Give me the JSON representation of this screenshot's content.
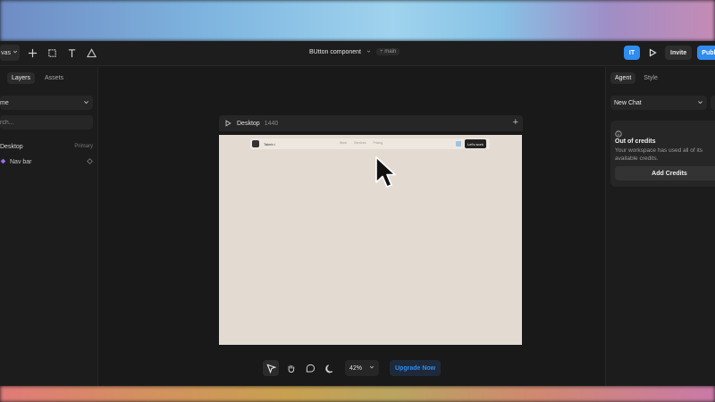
{
  "app": {
    "project_title": "BUtton component",
    "branch": "main",
    "mode_label": "vas",
    "avatar_initials": "IT",
    "invite_label": "Invite",
    "publish_label": "Publ"
  },
  "left_panel": {
    "tabs": [
      "Layers",
      "Assets"
    ],
    "page_select": "me",
    "search_placeholder": "rch...",
    "layers": {
      "frame_name": "Desktop",
      "frame_tag": "Primary",
      "child_name": "Nav bar"
    }
  },
  "canvas": {
    "frame_name": "Desktop",
    "frame_size": "1440",
    "preview": {
      "brand": "Takeb.i",
      "links": [
        "Work",
        "Services",
        "Pricing"
      ],
      "cta": "Let's work"
    },
    "zoom": "42%",
    "upgrade_label": "Upgrade Now"
  },
  "right_panel": {
    "tabs": [
      "Agent",
      "Style"
    ],
    "chat_select": "New Chat",
    "credits": {
      "title": "Out of credits",
      "description": "Your workspace has used all of its available credits.",
      "button": "Add Credits"
    }
  },
  "colors": {
    "accent": "#2f8cf0",
    "panel": "#1c1c1c",
    "canvas": "#191919",
    "frame_bg": "#e3dbd2"
  },
  "icons": [
    "plus-icon",
    "frame-icon",
    "text-icon",
    "triangle-icon",
    "play-icon",
    "pointer-icon",
    "hand-icon",
    "comment-icon",
    "moon-icon",
    "chevron-down-icon",
    "info-icon",
    "component-icon",
    "arrow-cursor-icon"
  ]
}
